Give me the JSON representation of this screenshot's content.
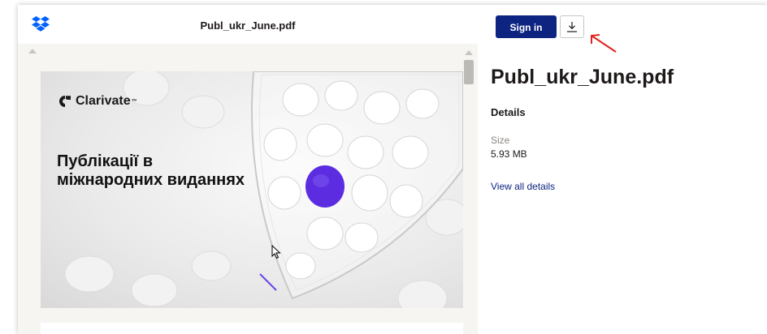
{
  "viewer": {
    "file_name": "Publ_ukr_June.pdf",
    "slide": {
      "brand": "Clarivate",
      "brand_tm": "™",
      "heading_line1": "Публікації в",
      "heading_line2": "міжнародних виданнях"
    }
  },
  "panel": {
    "signin_label": "Sign in",
    "title": "Publ_ukr_June.pdf",
    "details_heading": "Details",
    "size_label": "Size",
    "size_value": "5.93 MB",
    "view_all_details": "View all details"
  },
  "colors": {
    "brand_blue": "#0d2481",
    "accent_purple": "#5b2ce0",
    "annotation_red": "#e0231c"
  },
  "icons": [
    "dropbox-logo-icon",
    "download-icon",
    "clarivate-logo-icon",
    "mouse-cursor-icon",
    "annotation-arrow-icon"
  ]
}
